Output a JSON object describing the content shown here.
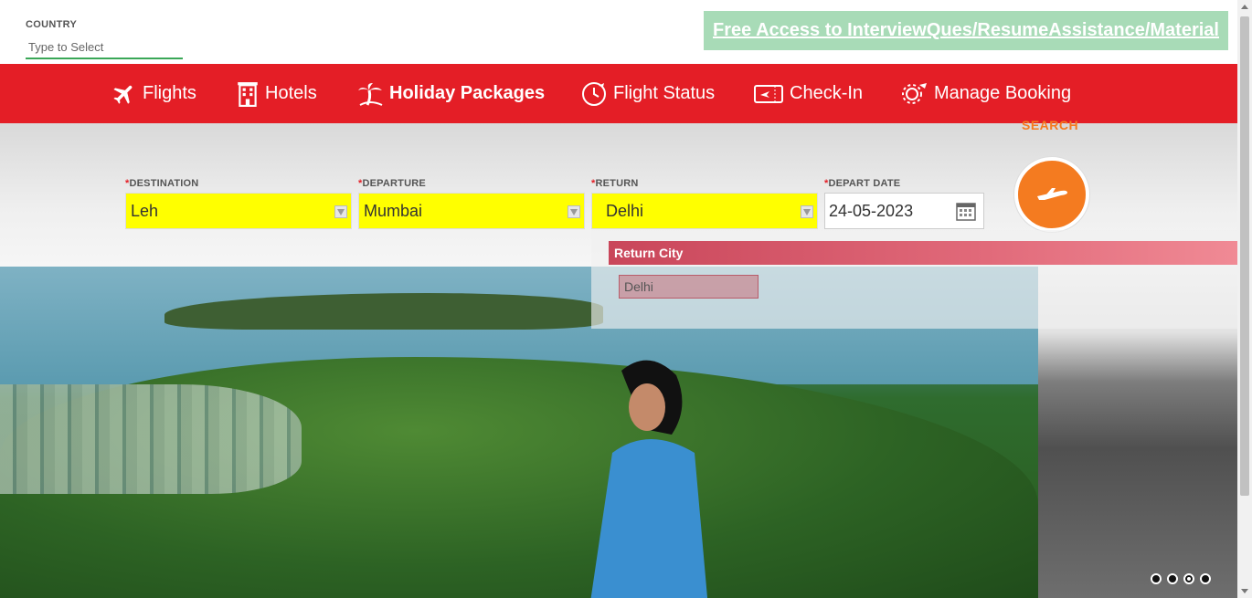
{
  "country": {
    "label": "COUNTRY",
    "placeholder": "Type to Select"
  },
  "promo": {
    "text": "Free Access to InterviewQues/ResumeAssistance/Material"
  },
  "nav": {
    "items": [
      {
        "label": "Flights",
        "icon": "plane-icon"
      },
      {
        "label": "Hotels",
        "icon": "hotel-icon"
      },
      {
        "label": "Holiday Packages",
        "icon": "palm-tree-icon",
        "active": true
      },
      {
        "label": "Flight Status",
        "icon": "clock-plane-icon"
      },
      {
        "label": "Check-In",
        "icon": "ticket-plane-icon"
      },
      {
        "label": "Manage Booking",
        "icon": "gear-plane-icon"
      }
    ]
  },
  "search": {
    "required_mark": "*",
    "destination": {
      "label": "DESTINATION",
      "value": "Leh"
    },
    "departure": {
      "label": "DEPARTURE",
      "value": "Mumbai"
    },
    "return": {
      "label": "RETURN",
      "value": "Delhi"
    },
    "depart_date": {
      "label": "DEPART DATE",
      "value": "24-05-2023"
    },
    "button_label": "SEARCH"
  },
  "return_dropdown": {
    "header": "Return City",
    "options": [
      "Delhi"
    ]
  },
  "carousel": {
    "dot_count": 4,
    "active_index": 2
  },
  "colors": {
    "nav_red": "#e41e26",
    "search_orange": "#f47b20",
    "select_yellow": "#ffff00",
    "promo_green": "#a8dbb7"
  }
}
